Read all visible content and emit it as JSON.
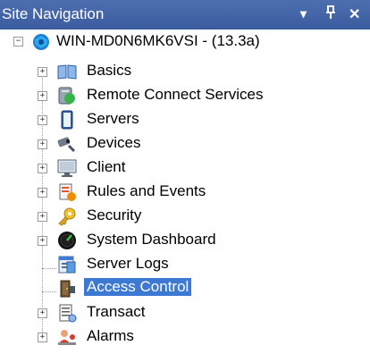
{
  "panel": {
    "title": "Site Navigation",
    "buttons": {
      "dropdown": "▾",
      "pin": "↓",
      "close": "✕"
    }
  },
  "tree": {
    "root_label": "WIN-MD0N6MK6VSI - (13.3a)",
    "items": [
      {
        "label": "Basics",
        "icon": "book-icon",
        "expandable": true
      },
      {
        "label": "Remote Connect Services",
        "icon": "remote-connect-icon",
        "expandable": true
      },
      {
        "label": "Servers",
        "icon": "server-icon",
        "expandable": true
      },
      {
        "label": "Devices",
        "icon": "devices-icon",
        "expandable": true
      },
      {
        "label": "Client",
        "icon": "client-monitor-icon",
        "expandable": true
      },
      {
        "label": "Rules and Events",
        "icon": "rules-events-icon",
        "expandable": true
      },
      {
        "label": "Security",
        "icon": "security-key-icon",
        "expandable": true
      },
      {
        "label": "System Dashboard",
        "icon": "dashboard-icon",
        "expandable": true
      },
      {
        "label": "Server Logs",
        "icon": "server-logs-icon",
        "expandable": false
      },
      {
        "label": "Access Control",
        "icon": "access-control-icon",
        "expandable": false,
        "selected": true
      },
      {
        "label": "Transact",
        "icon": "transact-icon",
        "expandable": true
      },
      {
        "label": "Alarms",
        "icon": "alarms-icon",
        "expandable": true
      }
    ]
  },
  "colors": {
    "title_bar": "#3b5c9e",
    "selection": "#3b79d3"
  }
}
